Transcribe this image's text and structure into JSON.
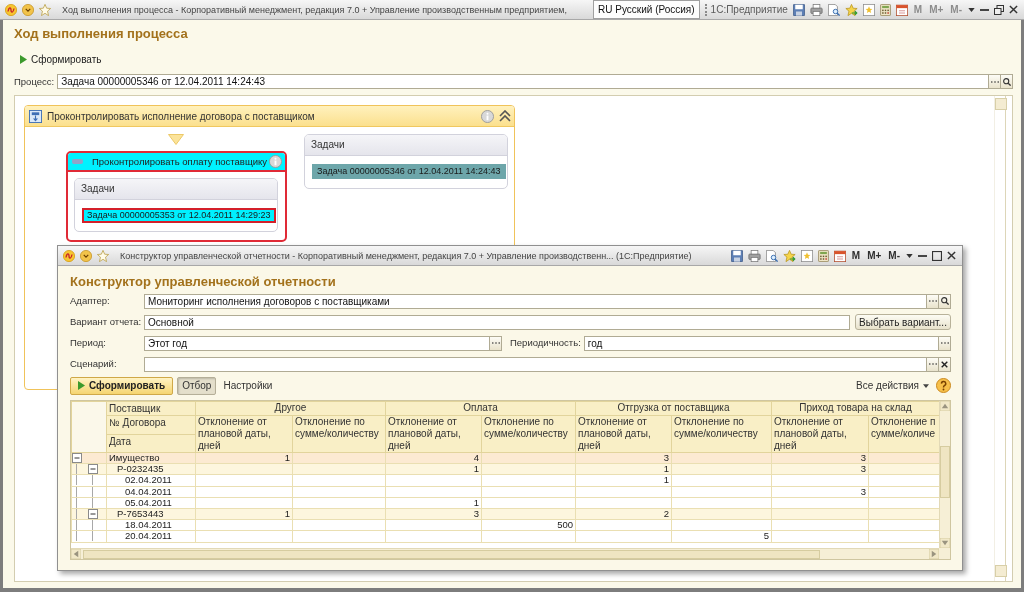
{
  "window": {
    "title": "Ход выполнения процесса - Корпоративный менеджмент, редакция 7.0 + Управление производственным предприятием,",
    "language": "RU Русский (Россия)",
    "app": "1С:Предприятие",
    "memory_buttons": [
      {
        "label": "M",
        "disabled": true
      },
      {
        "label": "M+",
        "disabled": true
      },
      {
        "label": "M-",
        "disabled": true
      }
    ],
    "maximized": true
  },
  "form": {
    "title": "Ход выполнения процесса",
    "run_button": "Сформировать",
    "process_field": {
      "label": "Процесс:",
      "value": "Задача 00000005346 от 12.04.2011 14:24:43"
    }
  },
  "diagram": {
    "group": {
      "title": "Проконтролировать исполнение договора с поставщиком",
      "expanded": true
    },
    "step": {
      "title": "Проконтролировать оплату поставщику",
      "selected": true,
      "tasks_title": "Задачи",
      "tasks": [
        {
          "text": "Задача 00000005353 от 12.04.2011 14:29:23",
          "selected": true
        }
      ]
    },
    "side_tasks": {
      "title": "Задачи",
      "tasks": [
        {
          "text": "Задача 00000005346 от 12.04.2011 14:24:43",
          "selected": false
        }
      ]
    }
  },
  "report_window": {
    "title": "Конструктор управленческой отчетности - Корпоративный менеджмент, редакция 7.0 + Управление производственн... (1С:Предприятие)",
    "memory_buttons": [
      {
        "label": "M",
        "disabled": false
      },
      {
        "label": "M+",
        "disabled": false
      },
      {
        "label": "M-",
        "disabled": false
      }
    ],
    "maximized": false,
    "form_title": "Конструктор управленческой отчетности",
    "fields": {
      "adapter": {
        "label": "Адаптер:",
        "value": "Мониторинг исполнения договоров с поставщиками"
      },
      "variant": {
        "label": "Вариант отчета:",
        "value": "Основной",
        "button": "Выбрать вариант..."
      },
      "period": {
        "label": "Период:",
        "value": "Этот год"
      },
      "periodicity": {
        "label": "Периодичность:",
        "value": "год"
      },
      "scenario": {
        "label": "Сценарий:"
      }
    },
    "toolbar": {
      "run_button": "Сформировать",
      "filter_button": {
        "label": "Отбор",
        "on": true
      },
      "settings_button": "Настройки",
      "actions_menu": "Все действия"
    },
    "table": {
      "key_headers": [
        "Поставщик",
        "№ Договора",
        "Дата"
      ],
      "groups": [
        {
          "title": "Другое",
          "columns": [
            "Отклонение от плановой даты, дней",
            "Отклонение по сумме/количеству"
          ]
        },
        {
          "title": "Оплата",
          "columns": [
            "Отклонение от плановой даты, дней",
            "Отклонение по сумме/количеству"
          ]
        },
        {
          "title": "Отгрузка от поставщика",
          "columns": [
            "Отклонение от плановой даты, дней",
            "Отклонение по сумме/количеству"
          ]
        },
        {
          "title": "Приход товара на склад",
          "columns": [
            "Отклонение от плановой даты, дней",
            "Отклонение п сумме/количе"
          ]
        }
      ],
      "rows": [
        {
          "label": "Имущество",
          "expanded": true,
          "values": {
            "other_days": "1",
            "payment_days": "4",
            "shipment_days": "3",
            "receipt_days": "3"
          },
          "children": [
            {
              "label": "Р-0232435",
              "expanded": true,
              "values": {
                "payment_days": "1",
                "shipment_days": "1",
                "receipt_days": "3"
              },
              "children": [
                {
                  "label": "02.04.2011",
                  "values": {
                    "shipment_days": "1"
                  }
                },
                {
                  "label": "04.04.2011",
                  "values": {
                    "receipt_days": "3"
                  }
                },
                {
                  "label": "05.04.2011",
                  "values": {
                    "payment_days": "1"
                  }
                }
              ]
            },
            {
              "label": "Р-7653443",
              "expanded": true,
              "values": {
                "other_days": "1",
                "payment_days": "3",
                "shipment_days": "2"
              },
              "children": [
                {
                  "label": "18.04.2011",
                  "values": {
                    "payment_amount": "500"
                  }
                },
                {
                  "label": "20.04.2011",
                  "values": {
                    "shipment_amount": "5"
                  }
                }
              ]
            }
          ]
        }
      ]
    }
  }
}
